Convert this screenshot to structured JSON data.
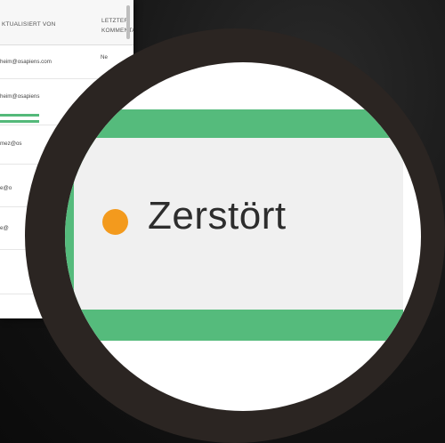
{
  "table": {
    "headers": {
      "updated_by": "KTUALISIERT VON",
      "last_comment": "LETZTER KOMMENTAR"
    },
    "rows": [
      {
        "updated_by": "heim@osapiens.com",
        "comment_a": "Ne",
        "comment_b": ""
      },
      {
        "updated_by": "heim@osapiens"
      },
      {
        "updated_by": "mez@os"
      },
      {
        "updated_by": "e@o"
      },
      {
        "updated_by": "e@"
      }
    ]
  },
  "zoom": {
    "status_label": "Zerstört",
    "status_color": "#f39a1d",
    "frame_color": "#55bb7c"
  }
}
